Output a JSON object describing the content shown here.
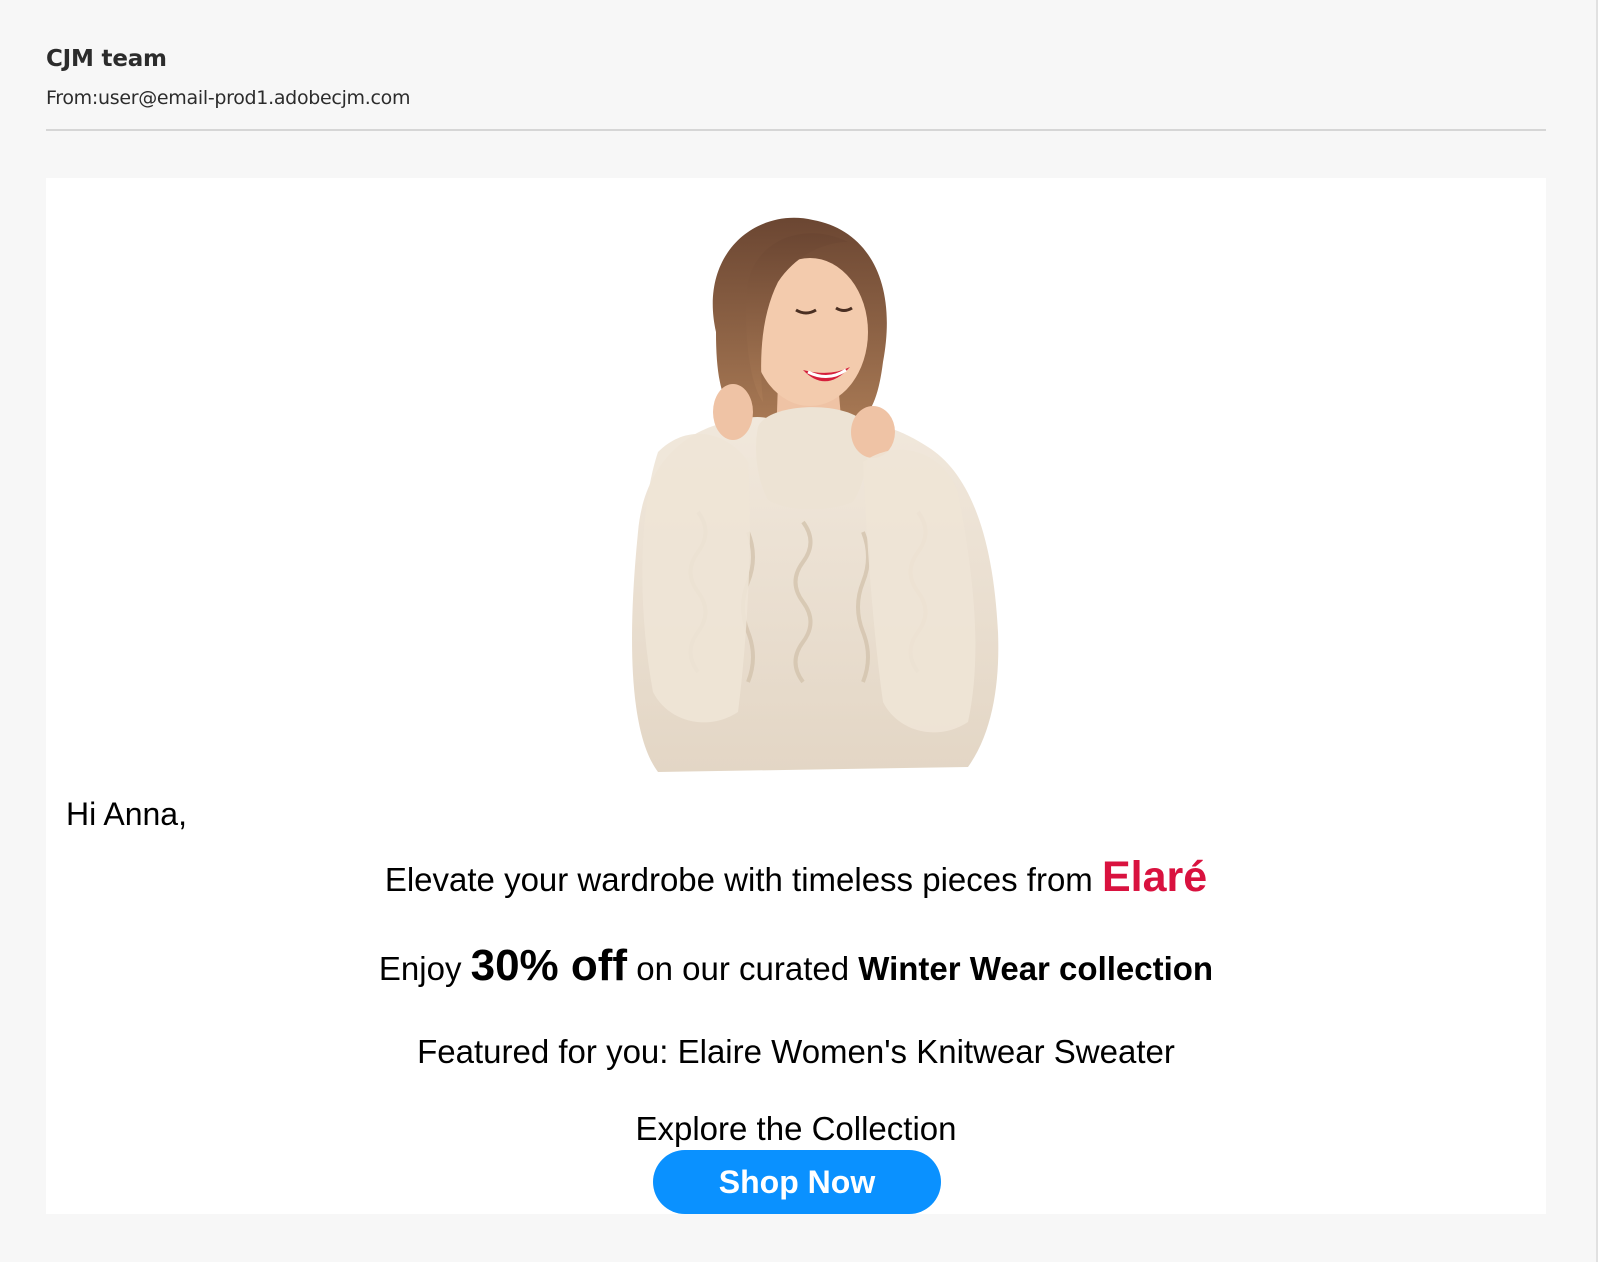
{
  "header": {
    "sender_name": "CJM team",
    "sender_email": "From:user@email-prod1.adobecjm.com"
  },
  "email": {
    "hero_image_alt": "Woman in cream cable-knit sweater",
    "greeting": "Hi Anna,",
    "elevate_text": "Elevate your wardrobe with timeless pieces from ",
    "brand_name": "Elaré",
    "offer_prefix": "Enjoy ",
    "offer_discount": "30% off",
    "offer_middle": " on our curated ",
    "offer_collection": "Winter Wear collection",
    "featured_text": "Featured for you: Elaire Women's Knitwear Sweater",
    "explore_text": "Explore the Collection",
    "cta_label": "Shop Now"
  },
  "colors": {
    "page_background": "#f7f7f7",
    "brand_accent": "#d9123f",
    "cta_background": "#0a91ff",
    "divider": "#d6d6d6"
  }
}
